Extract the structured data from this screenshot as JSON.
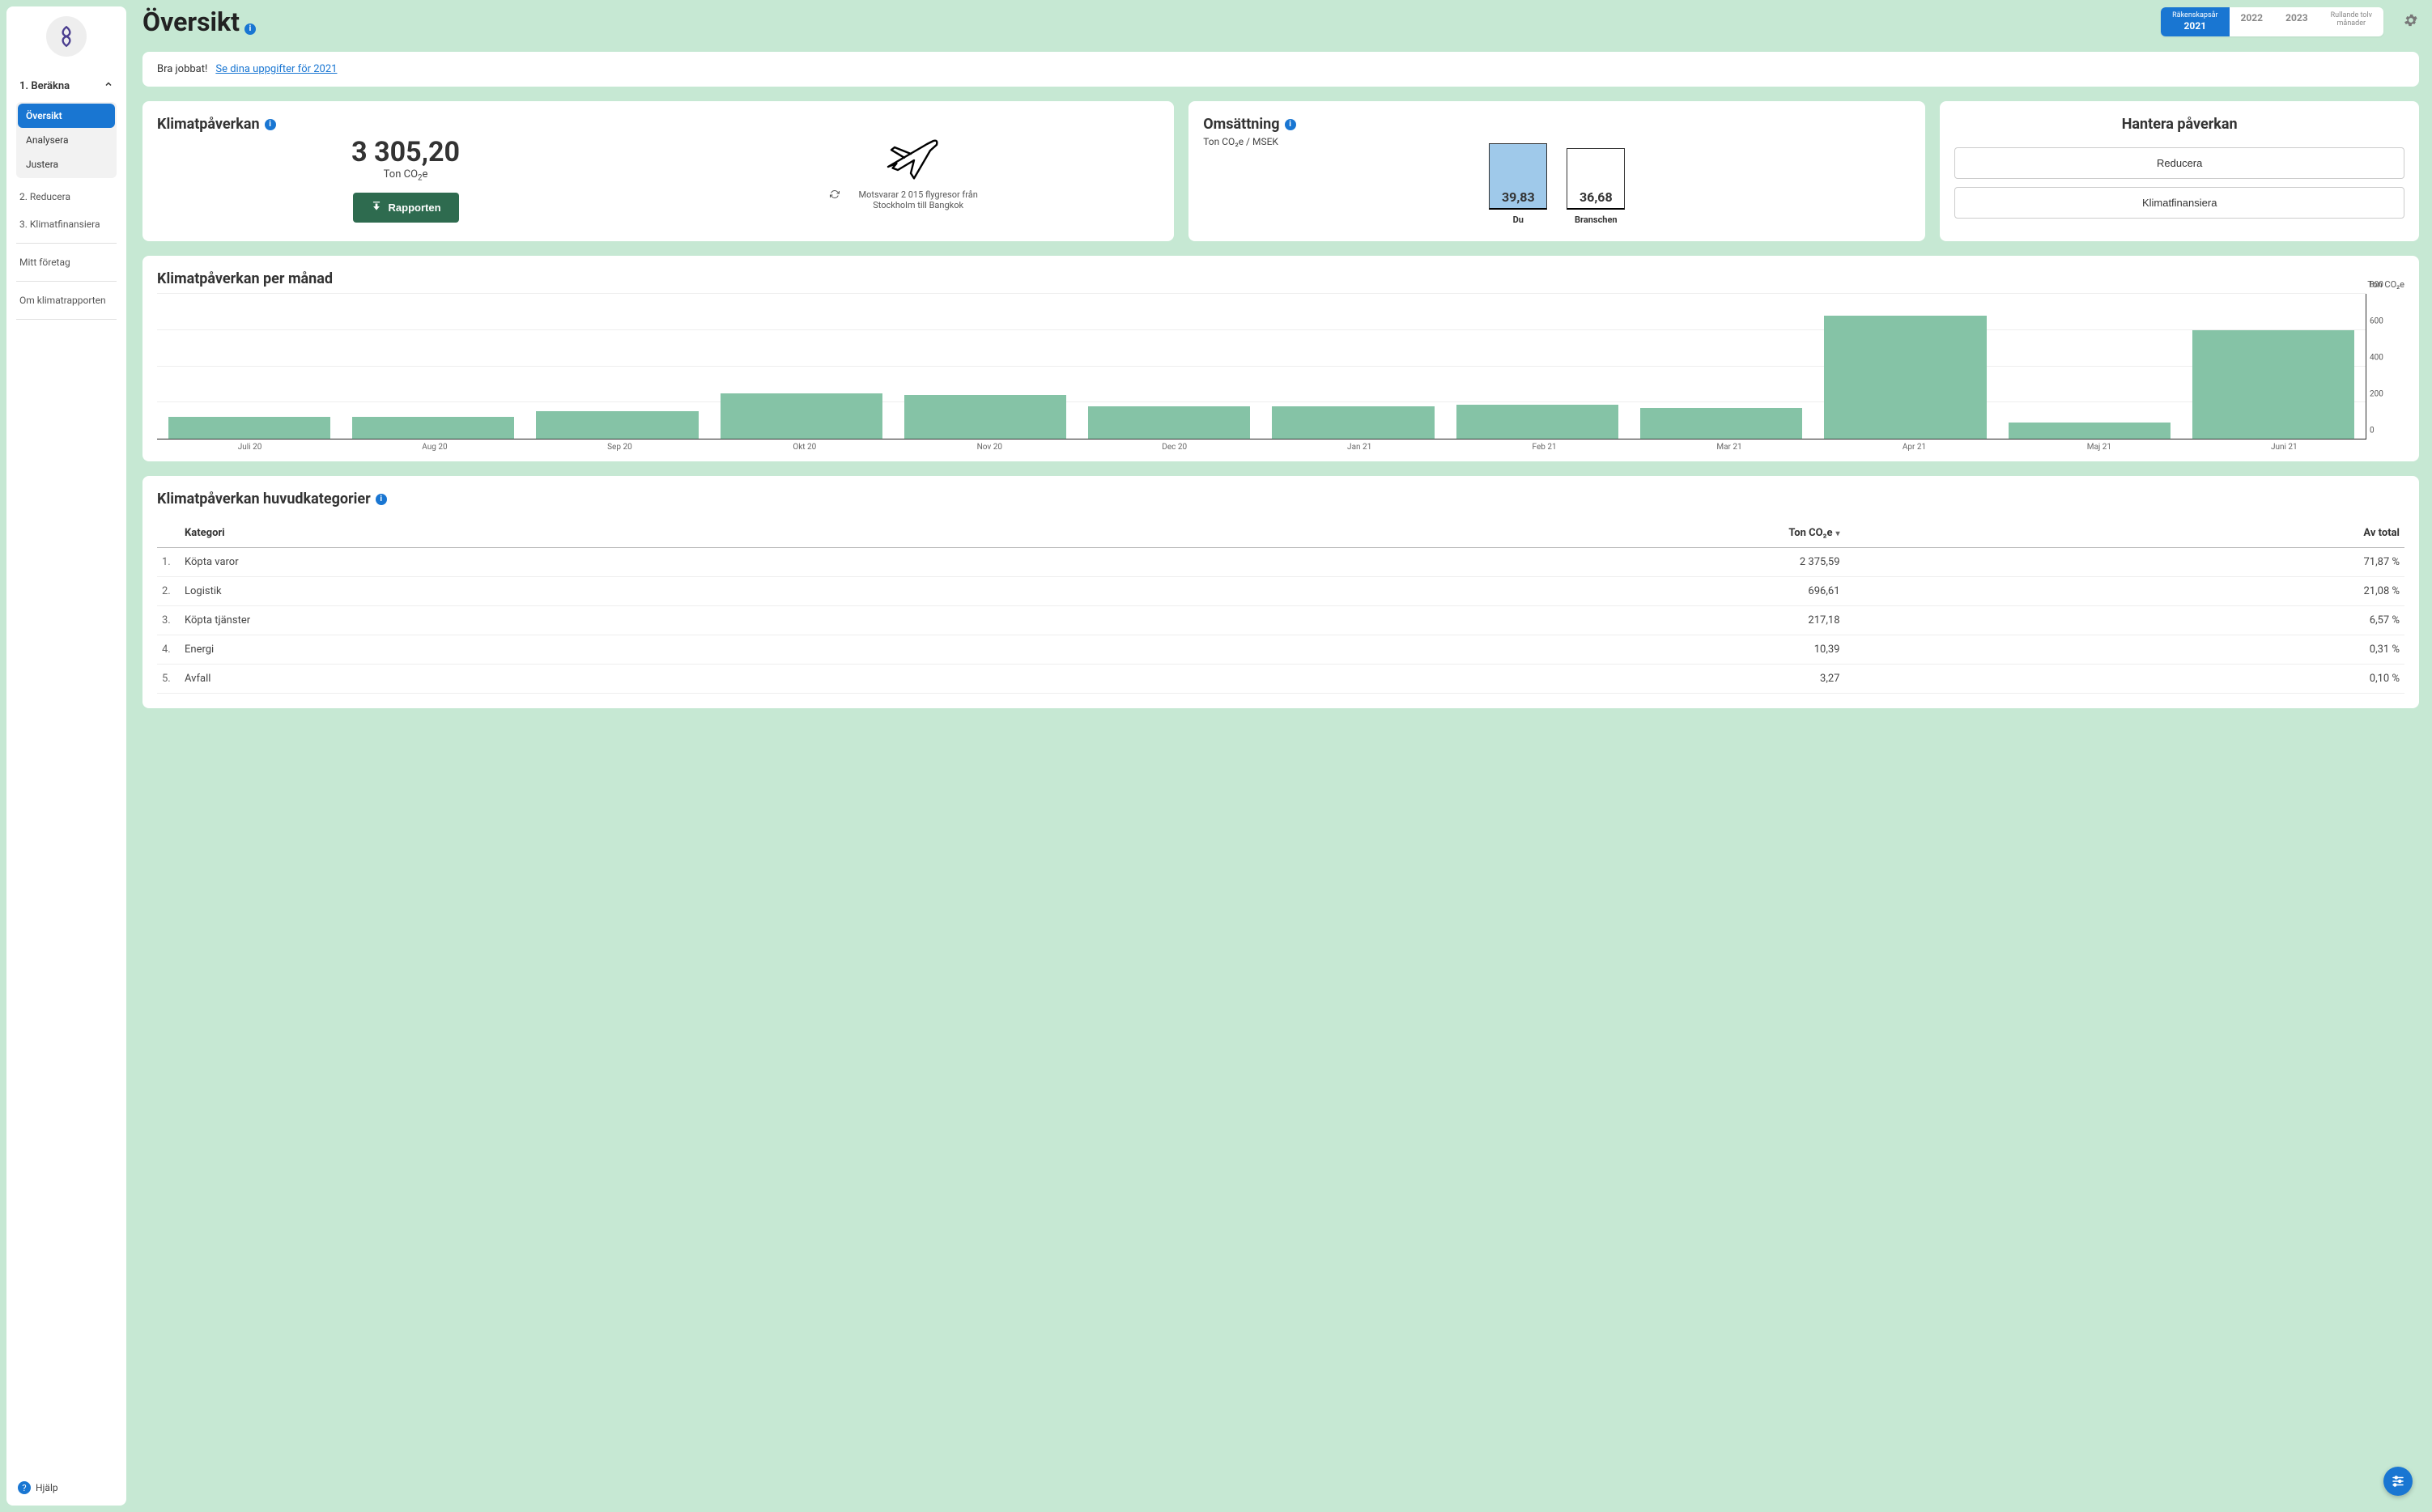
{
  "page": {
    "title": "Översikt"
  },
  "year_tabs": {
    "prefix_label": "Räkenskapsår",
    "active": "2021",
    "items": [
      "2021",
      "2022",
      "2023"
    ],
    "rolling_label_1": "Rullande tolv",
    "rolling_label_2": "månader"
  },
  "banner": {
    "prefix": "Bra jobbat!",
    "link": "Se dina uppgifter för 2021"
  },
  "sidebar": {
    "section1": {
      "label": "1. Beräkna"
    },
    "subitems": [
      {
        "label": "Översikt",
        "active": true
      },
      {
        "label": "Analysera",
        "active": false
      },
      {
        "label": "Justera",
        "active": false
      }
    ],
    "items": [
      {
        "label": "2. Reducera"
      },
      {
        "label": "3. Klimatfinansiera"
      }
    ],
    "extra": [
      {
        "label": "Mitt företag"
      },
      {
        "label": "Om klimatrapporten"
      }
    ],
    "help": "Hjälp"
  },
  "impact": {
    "title": "Klimatpåverkan",
    "value": "3 305,20",
    "unit_prefix": "Ton CO",
    "unit_suffix": "e",
    "button": "Rapporten",
    "equiv": "Motsvarar 2 015 flygresor från Stockholm till Bangkok"
  },
  "turnover": {
    "title": "Omsättning",
    "sub": "Ton CO₂e / MSEK",
    "you_label": "Du",
    "you_value": "39,83",
    "industry_label": "Branschen",
    "industry_value": "36,68"
  },
  "manage": {
    "title": "Hantera påverkan",
    "btn1": "Reducera",
    "btn2": "Klimatfinansiera"
  },
  "monthly": {
    "title": "Klimatpåverkan per månad",
    "y_title": "Ton CO₂e"
  },
  "chart_data": {
    "type": "bar",
    "categories": [
      "Juli 20",
      "Aug 20",
      "Sep 20",
      "Okt 20",
      "Nov 20",
      "Dec 20",
      "Jan 21",
      "Feb 21",
      "Mar 21",
      "Apr 21",
      "Maj 21",
      "Juni 21"
    ],
    "values": [
      120,
      120,
      150,
      250,
      240,
      180,
      180,
      190,
      170,
      680,
      90,
      600
    ],
    "ylabel": "Ton CO₂e",
    "ylim": [
      0,
      800
    ],
    "yticks": [
      0,
      200,
      400,
      600,
      800
    ]
  },
  "categories": {
    "title": "Klimatpåverkan huvudkategorier",
    "headers": {
      "cat": "Kategori",
      "ton": "Ton CO₂e",
      "total": "Av total"
    },
    "rows": [
      {
        "idx": "1.",
        "name": "Köpta varor",
        "ton": "2 375,59",
        "pct": "71,87 %"
      },
      {
        "idx": "2.",
        "name": "Logistik",
        "ton": "696,61",
        "pct": "21,08 %"
      },
      {
        "idx": "3.",
        "name": "Köpta tjänster",
        "ton": "217,18",
        "pct": "6,57 %"
      },
      {
        "idx": "4.",
        "name": "Energi",
        "ton": "10,39",
        "pct": "0,31 %"
      },
      {
        "idx": "5.",
        "name": "Avfall",
        "ton": "3,27",
        "pct": "0,10 %"
      }
    ]
  }
}
